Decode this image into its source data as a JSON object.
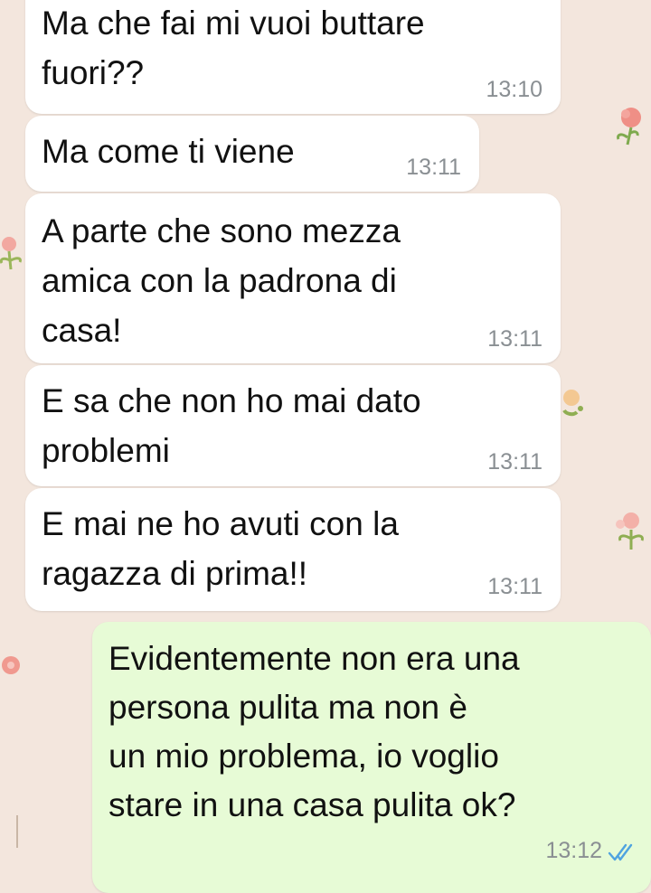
{
  "messages": [
    {
      "direction": "incoming",
      "text": "Ma che fai mi vuoi buttare\nfuori??",
      "time": "13:10"
    },
    {
      "direction": "incoming",
      "text": "Ma come ti viene",
      "time": "13:11"
    },
    {
      "direction": "incoming",
      "text": "A parte che sono mezza\namica con la padrona di\ncasa!",
      "time": "13:11"
    },
    {
      "direction": "incoming",
      "text": "E sa che non ho mai dato\nproblemi",
      "time": "13:11"
    },
    {
      "direction": "incoming",
      "text": "E mai ne ho avuti con la\nragazza di prima!!",
      "time": "13:11"
    },
    {
      "direction": "outgoing",
      "text": "Evidentemente non era una\npersona pulita ma non è\nun mio problema, io voglio\nstare in una casa pulita ok?",
      "time": "13:12",
      "status_icon": "double-check-read-icon"
    }
  ],
  "colors": {
    "wallpaper": "#f3e6dd",
    "incoming_bubble": "#ffffff",
    "outgoing_bubble": "#e7fbd6",
    "timestamp": "#8a8f93",
    "read_ticks": "#4fa3e0"
  }
}
